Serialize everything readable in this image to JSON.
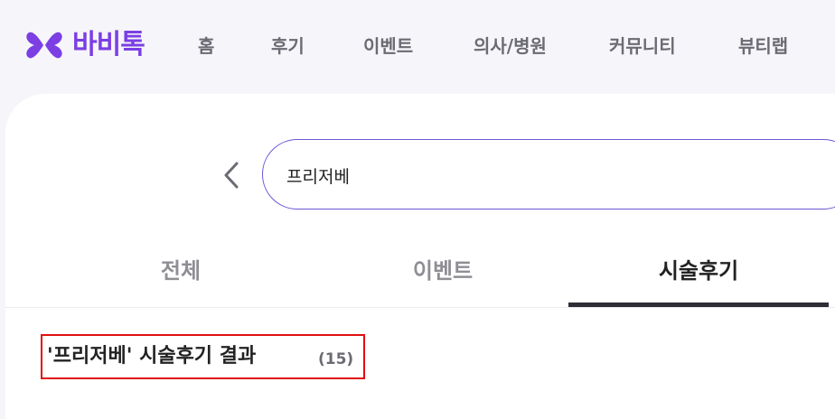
{
  "brand": {
    "name": "바비톡",
    "color": "#7b3fe4",
    "logo_icon": "butterfly-logo-icon"
  },
  "nav": {
    "items": [
      "홈",
      "후기",
      "이벤트",
      "의사/병원",
      "커뮤니티",
      "뷰티랩"
    ]
  },
  "search": {
    "value": "프리저베",
    "back_icon": "chevron-left-icon"
  },
  "tabs": {
    "items": [
      "전체",
      "이벤트",
      "시술후기"
    ],
    "active_index": 2
  },
  "results": {
    "title": "'프리저베' 시술후기 결과",
    "count": "(15)"
  },
  "colors": {
    "accent": "#6c55d6",
    "highlight_border": "#e01010",
    "active_tab": "#2d2d35"
  }
}
